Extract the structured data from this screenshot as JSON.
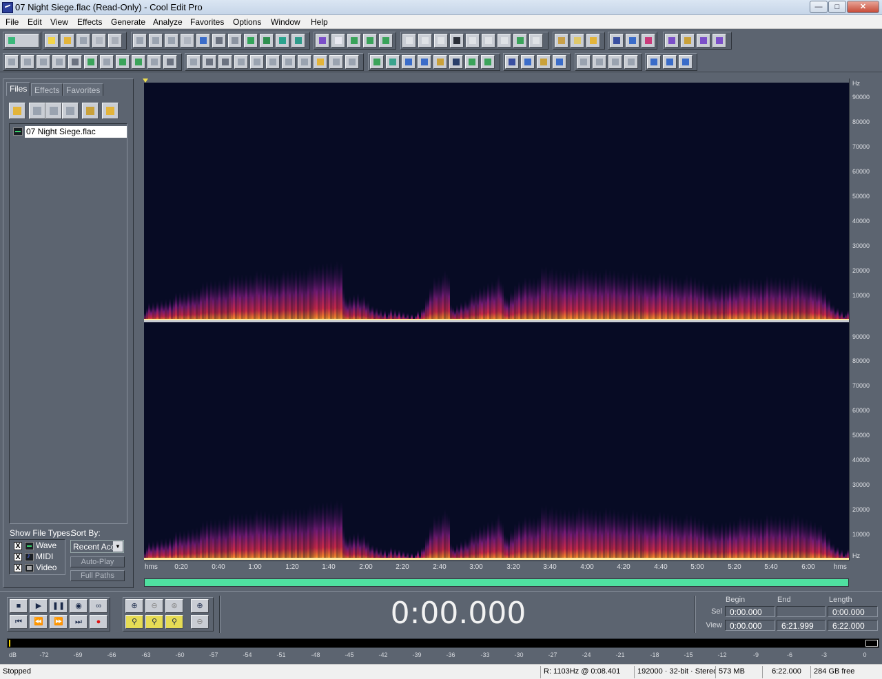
{
  "window": {
    "title": "07 Night Siege.flac (Read-Only) - Cool Edit Pro"
  },
  "menu": [
    "File",
    "Edit",
    "View",
    "Effects",
    "Generate",
    "Analyze",
    "Favorites",
    "Options",
    "Window",
    "Help"
  ],
  "panel": {
    "tabs": [
      "Files",
      "Effects",
      "Favorites"
    ],
    "file": "07 Night Siege.flac",
    "show_types_label": "Show File Types:",
    "sort_label": "Sort By:",
    "types": [
      {
        "label": "Wave",
        "checked": "X"
      },
      {
        "label": "MIDI",
        "checked": "X"
      },
      {
        "label": "Video",
        "checked": "X"
      }
    ],
    "sort_value": "Recent Acc",
    "auto_play": "Auto-Play",
    "full_paths": "Full Paths"
  },
  "spectral": {
    "hz_unit": "Hz",
    "freq_labels": [
      "90000",
      "80000",
      "70000",
      "60000",
      "50000",
      "40000",
      "30000",
      "20000",
      "10000"
    ],
    "time_labels": [
      "hms",
      "0:20",
      "0:40",
      "1:00",
      "1:20",
      "1:40",
      "2:00",
      "2:20",
      "2:40",
      "3:00",
      "3:20",
      "3:40",
      "4:00",
      "4:20",
      "4:40",
      "5:00",
      "5:20",
      "5:40",
      "6:00",
      "hms"
    ]
  },
  "transport": {
    "time": "0:00.000",
    "headers": {
      "begin": "Begin",
      "end": "End",
      "length": "Length"
    },
    "sel": {
      "label": "Sel",
      "begin": "0:00.000",
      "end": "",
      "length": "0:00.000"
    },
    "view": {
      "label": "View",
      "begin": "0:00.000",
      "end": "6:21.999",
      "length": "6:22.000"
    }
  },
  "meter": {
    "labels": [
      "dB",
      "-72",
      "-69",
      "-66",
      "-63",
      "-60",
      "-57",
      "-54",
      "-51",
      "-48",
      "-45",
      "-42",
      "-39",
      "-36",
      "-33",
      "-30",
      "-27",
      "-24",
      "-21",
      "-18",
      "-15",
      "-12",
      "-9",
      "-6",
      "-3",
      "0"
    ]
  },
  "status": {
    "state": "Stopped",
    "cursor": "R: 1103Hz @   0:08.401",
    "format": "192000 · 32-bit · Stereo",
    "size": "573 MB",
    "duration": "6:22.000",
    "free": "284 GB free"
  }
}
